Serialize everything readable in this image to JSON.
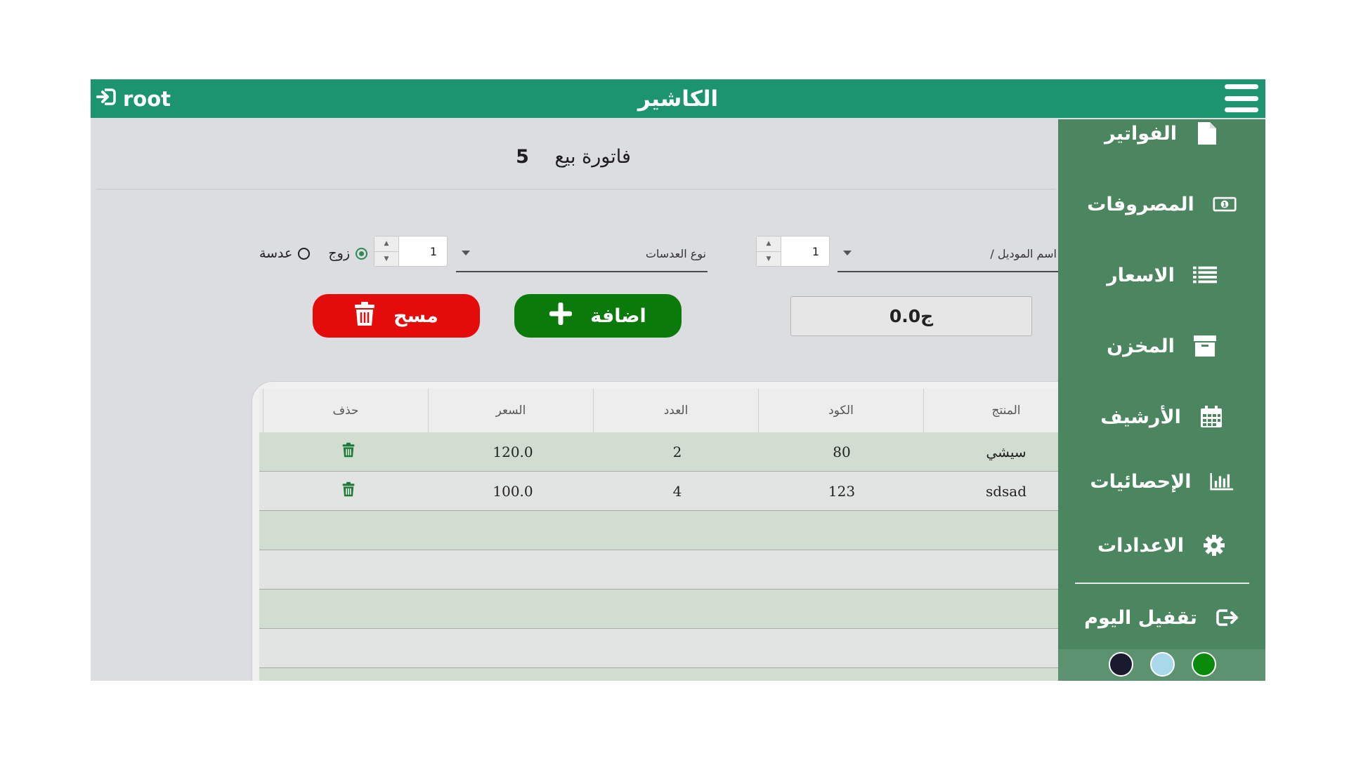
{
  "topbar": {
    "user": "root",
    "title": "الكاشير"
  },
  "invoice": {
    "label": "فاتورة بيع",
    "number": "5"
  },
  "form": {
    "model_label": "اسم الموديل /",
    "model_qty": "1",
    "lens_type_label": "نوع العدسات",
    "lens_qty": "1",
    "radio_pair": "زوج",
    "radio_lens": "عدسة",
    "total": "0.0ج",
    "add_label": "اضافة",
    "clear_label": "مسح"
  },
  "table": {
    "headers": [
      "المنتج",
      "الكود",
      "العدد",
      "السعر",
      "حذف"
    ],
    "rows": [
      {
        "product": "سيشي",
        "code": "80",
        "count": "2",
        "price": "120.0"
      },
      {
        "product": "sdsad",
        "code": "123",
        "count": "4",
        "price": "100.0"
      }
    ]
  },
  "menu": {
    "items": [
      {
        "label": "الفواتير",
        "icon": "file-icon"
      },
      {
        "label": "المصروفات",
        "icon": "money-icon"
      },
      {
        "label": "الاسعار",
        "icon": "list-icon"
      },
      {
        "label": "المخزن",
        "icon": "archive-box-icon"
      },
      {
        "label": "الأرشيف",
        "icon": "calendar-icon"
      },
      {
        "label": "الإحصائيات",
        "icon": "bar-chart-icon"
      },
      {
        "label": "الاعدادات",
        "icon": "gear-icon"
      },
      {
        "label": "تقفيل اليوم",
        "icon": "sign-out-icon"
      }
    ],
    "themes": [
      "#1a1a2e",
      "#a8d8ea",
      "#0a8a0a"
    ]
  }
}
